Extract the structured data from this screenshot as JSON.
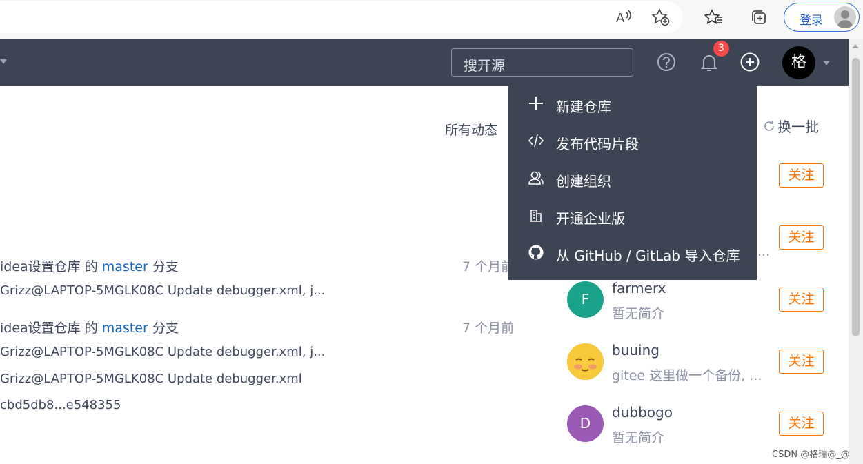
{
  "browser": {
    "read_aloud_icon": "read-aloud-icon",
    "add_favorite_icon": "add-favorite-icon",
    "favorites_icon": "favorites-icon",
    "collections_icon": "collections-icon",
    "login_label": "登录"
  },
  "header": {
    "search_placeholder": "搜开源",
    "notification_count": "3",
    "user_initial": "格"
  },
  "dropdown": {
    "items": [
      {
        "icon": "plus-icon",
        "label": "新建仓库"
      },
      {
        "icon": "code-icon",
        "label": "发布代码片段"
      },
      {
        "icon": "group-icon",
        "label": "创建组织"
      },
      {
        "icon": "building-icon",
        "label": "开通企业版"
      },
      {
        "icon": "github-icon",
        "label": "从 GitHub / GitLab 导入仓库"
      }
    ]
  },
  "feed": {
    "filter_label": "所有动态",
    "events": [
      {
        "prefix": "idea设置仓库 的 ",
        "branch": "master",
        "suffix": " 分支",
        "time": "7 个月前",
        "commits": [
          "Grizz@LAPTOP-5MGLK08C Update debugger.xml, j..."
        ]
      },
      {
        "prefix": "idea设置仓库 的 ",
        "branch": "master",
        "suffix": " 分支",
        "time": "7 个月前",
        "commits": [
          "Grizz@LAPTOP-5MGLK08C Update debugger.xml, j...",
          "Grizz@LAPTOP-5MGLK08C Update debugger.xml",
          "cbd5db8...e548355"
        ]
      }
    ]
  },
  "recommend": {
    "refresh_label": "换一批",
    "follow_label": "关注",
    "hidden_desc_ellipsis": "...",
    "users": [
      {
        "initial": "F",
        "name": "farmerx",
        "desc": "暂无简介",
        "color": "#1aa38a"
      },
      {
        "initial": "",
        "name": "buuing",
        "desc": "gitee 这里做一个备份, ...",
        "color": "#f7c23a"
      },
      {
        "initial": "D",
        "name": "dubbogo",
        "desc": "暂无简介",
        "color": "#9b59b6"
      }
    ]
  },
  "watermark": "CSDN @格瑞@_@"
}
